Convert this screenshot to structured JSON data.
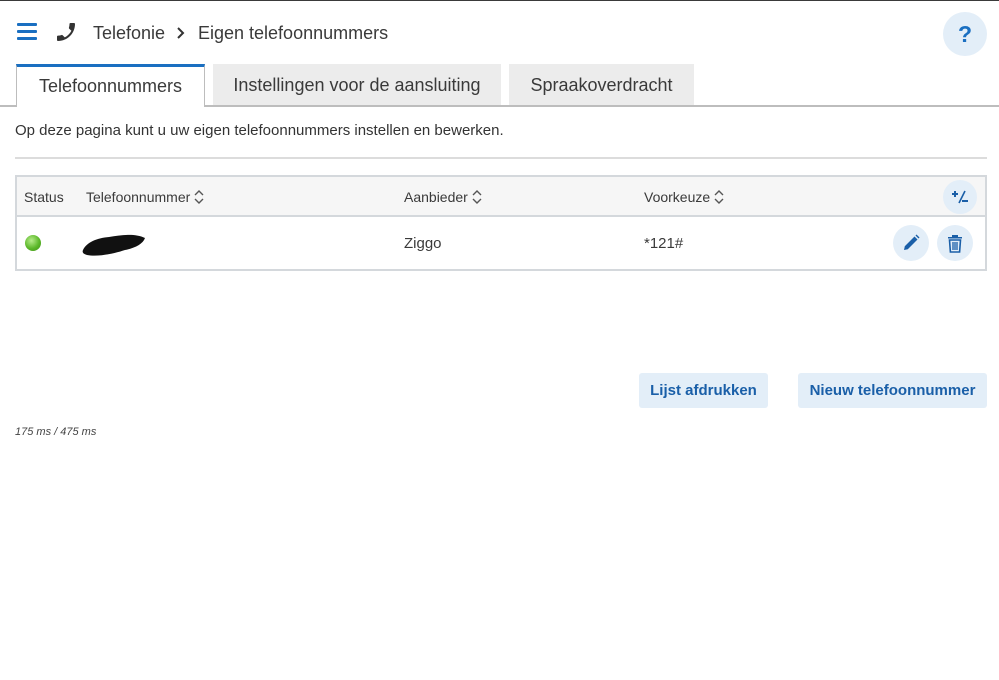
{
  "header": {
    "breadcrumb": [
      "Telefonie",
      "Eigen telefoonnummers"
    ],
    "help_label": "?"
  },
  "tabs": [
    {
      "label": "Telefoonnummers",
      "active": true
    },
    {
      "label": "Instellingen voor de aansluiting",
      "active": false
    },
    {
      "label": "Spraakoverdracht",
      "active": false
    }
  ],
  "intro": "Op deze pagina kunt u uw eigen telefoonnummers instellen en bewerken.",
  "table": {
    "columns": [
      "Status",
      "Telefoonnummer",
      "Aanbieder",
      "Voorkeuze"
    ],
    "rows": [
      {
        "status": "active",
        "phone_number": "",
        "provider": "Ziggo",
        "prefix": "*121#"
      }
    ]
  },
  "buttons": {
    "print": "Lijst afdrukken",
    "new": "Nieuw telefoonnummer"
  },
  "timing": "175 ms / 475 ms",
  "colors": {
    "accent": "#1a6fc1",
    "button_bg": "#e3eef8",
    "status_ok": "#5cb82a"
  },
  "icons": [
    "menu-icon",
    "phone-icon",
    "chevron-right-icon",
    "help-icon",
    "sort-icon",
    "column-toggle-icon",
    "edit-icon",
    "trash-icon"
  ]
}
